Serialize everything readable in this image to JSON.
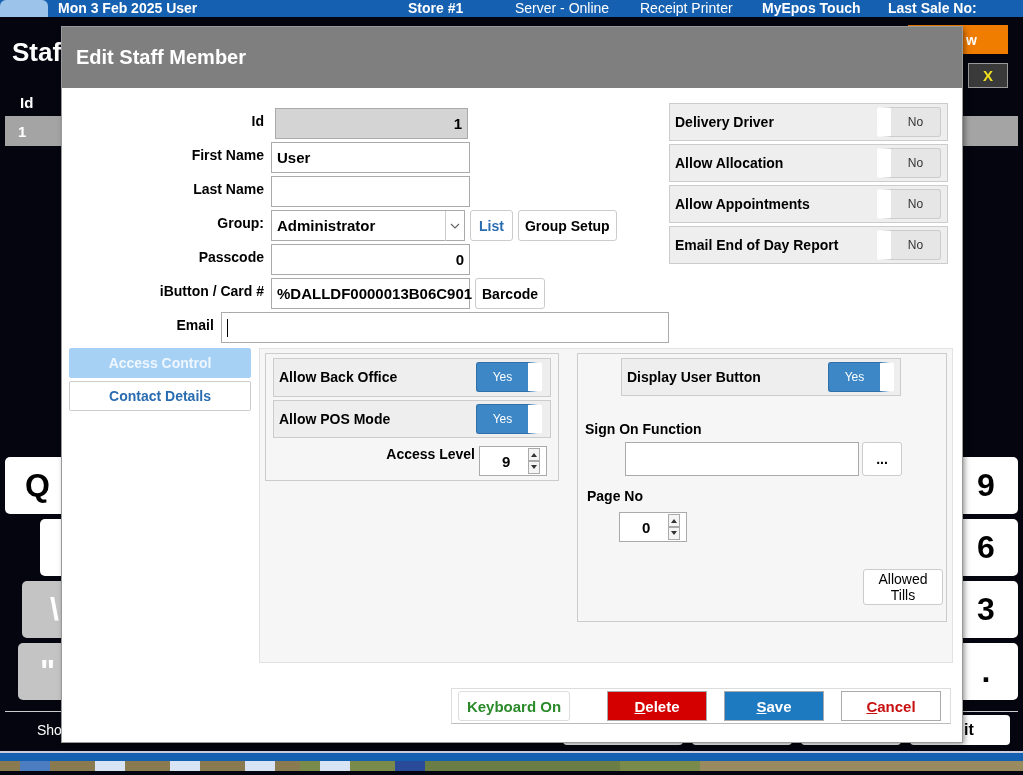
{
  "status_bar": {
    "items": [
      "Mon 3 Feb 2025  User",
      "Store #1",
      "Server - Online",
      "Receipt Printer",
      "MyEpos Touch",
      "Last Sale No:"
    ]
  },
  "screen": {
    "title": "Staf",
    "new_button": "w",
    "close_button": "X",
    "table": {
      "columns": [
        "Id"
      ],
      "rows": [
        [
          "1"
        ]
      ]
    },
    "keys_left": [
      {
        "kind": "letter",
        "label": "Q"
      },
      {
        "kind": "blank"
      },
      {
        "kind": "symbol",
        "label": "\\"
      },
      {
        "kind": "symbol",
        "label": "\""
      }
    ],
    "keys_right": [
      {
        "label": "9"
      },
      {
        "label": "6"
      },
      {
        "label": "3"
      },
      {
        "label": "."
      }
    ],
    "footer_text": "Sho",
    "footer_buttons": [
      {
        "kind": "blank"
      },
      {
        "kind": "blank"
      },
      {
        "kind": "blank"
      },
      {
        "kind": "text",
        "label": "it"
      }
    ]
  },
  "dialog": {
    "title": "Edit Staff Member",
    "fields": [
      {
        "kind": "readonly",
        "label": "Id",
        "value": "1"
      },
      {
        "kind": "text",
        "label": "First Name",
        "value": "User"
      },
      {
        "kind": "text",
        "label": "Last Name"
      },
      {
        "kind": "select",
        "label": "Group:",
        "value": "Administrator",
        "buttons": [
          "List",
          "Group Setup"
        ]
      },
      {
        "kind": "number",
        "label": "Passcode",
        "value": "0"
      },
      {
        "kind": "text",
        "label": "iButton / Card #",
        "value": "%DALLDF0000013B06C901",
        "buttons": [
          "Barcode"
        ]
      },
      {
        "kind": "wide",
        "label": "Email",
        "focused": true
      }
    ],
    "flags": [
      {
        "label": "Delivery Driver",
        "on": false,
        "state_text": "No"
      },
      {
        "label": "Allow Allocation",
        "on": false,
        "state_text": "No"
      },
      {
        "label": "Allow Appointments",
        "on": false,
        "state_text": "No"
      },
      {
        "label": "Email End of Day Report",
        "on": false,
        "state_text": "No"
      }
    ],
    "tabs": [
      {
        "label": "Access Control",
        "selected": true
      },
      {
        "label": "Contact Details",
        "selected": false
      }
    ],
    "access": {
      "toggles": [
        {
          "label": "Allow Back Office",
          "on": true,
          "state_text": "Yes"
        },
        {
          "label": "Allow POS Mode",
          "on": true,
          "state_text": "Yes"
        }
      ],
      "access_level": {
        "label": "Access Level",
        "value": "9"
      }
    },
    "display": {
      "toggle": {
        "label": "Display User Button",
        "on": true,
        "state_text": "Yes"
      },
      "sign_on_function": {
        "label": "Sign On Function",
        "browse_button": "..."
      },
      "page_no": {
        "label": "Page No",
        "value": "0"
      },
      "allowed_tills_button": "Allowed Tills"
    },
    "actions": [
      {
        "kind": "keyboard",
        "label": "Keyboard On"
      },
      {
        "kind": "delete",
        "label": "Delete"
      },
      {
        "kind": "save",
        "label": "Save"
      },
      {
        "kind": "cancel",
        "label": "Cancel"
      }
    ]
  }
}
